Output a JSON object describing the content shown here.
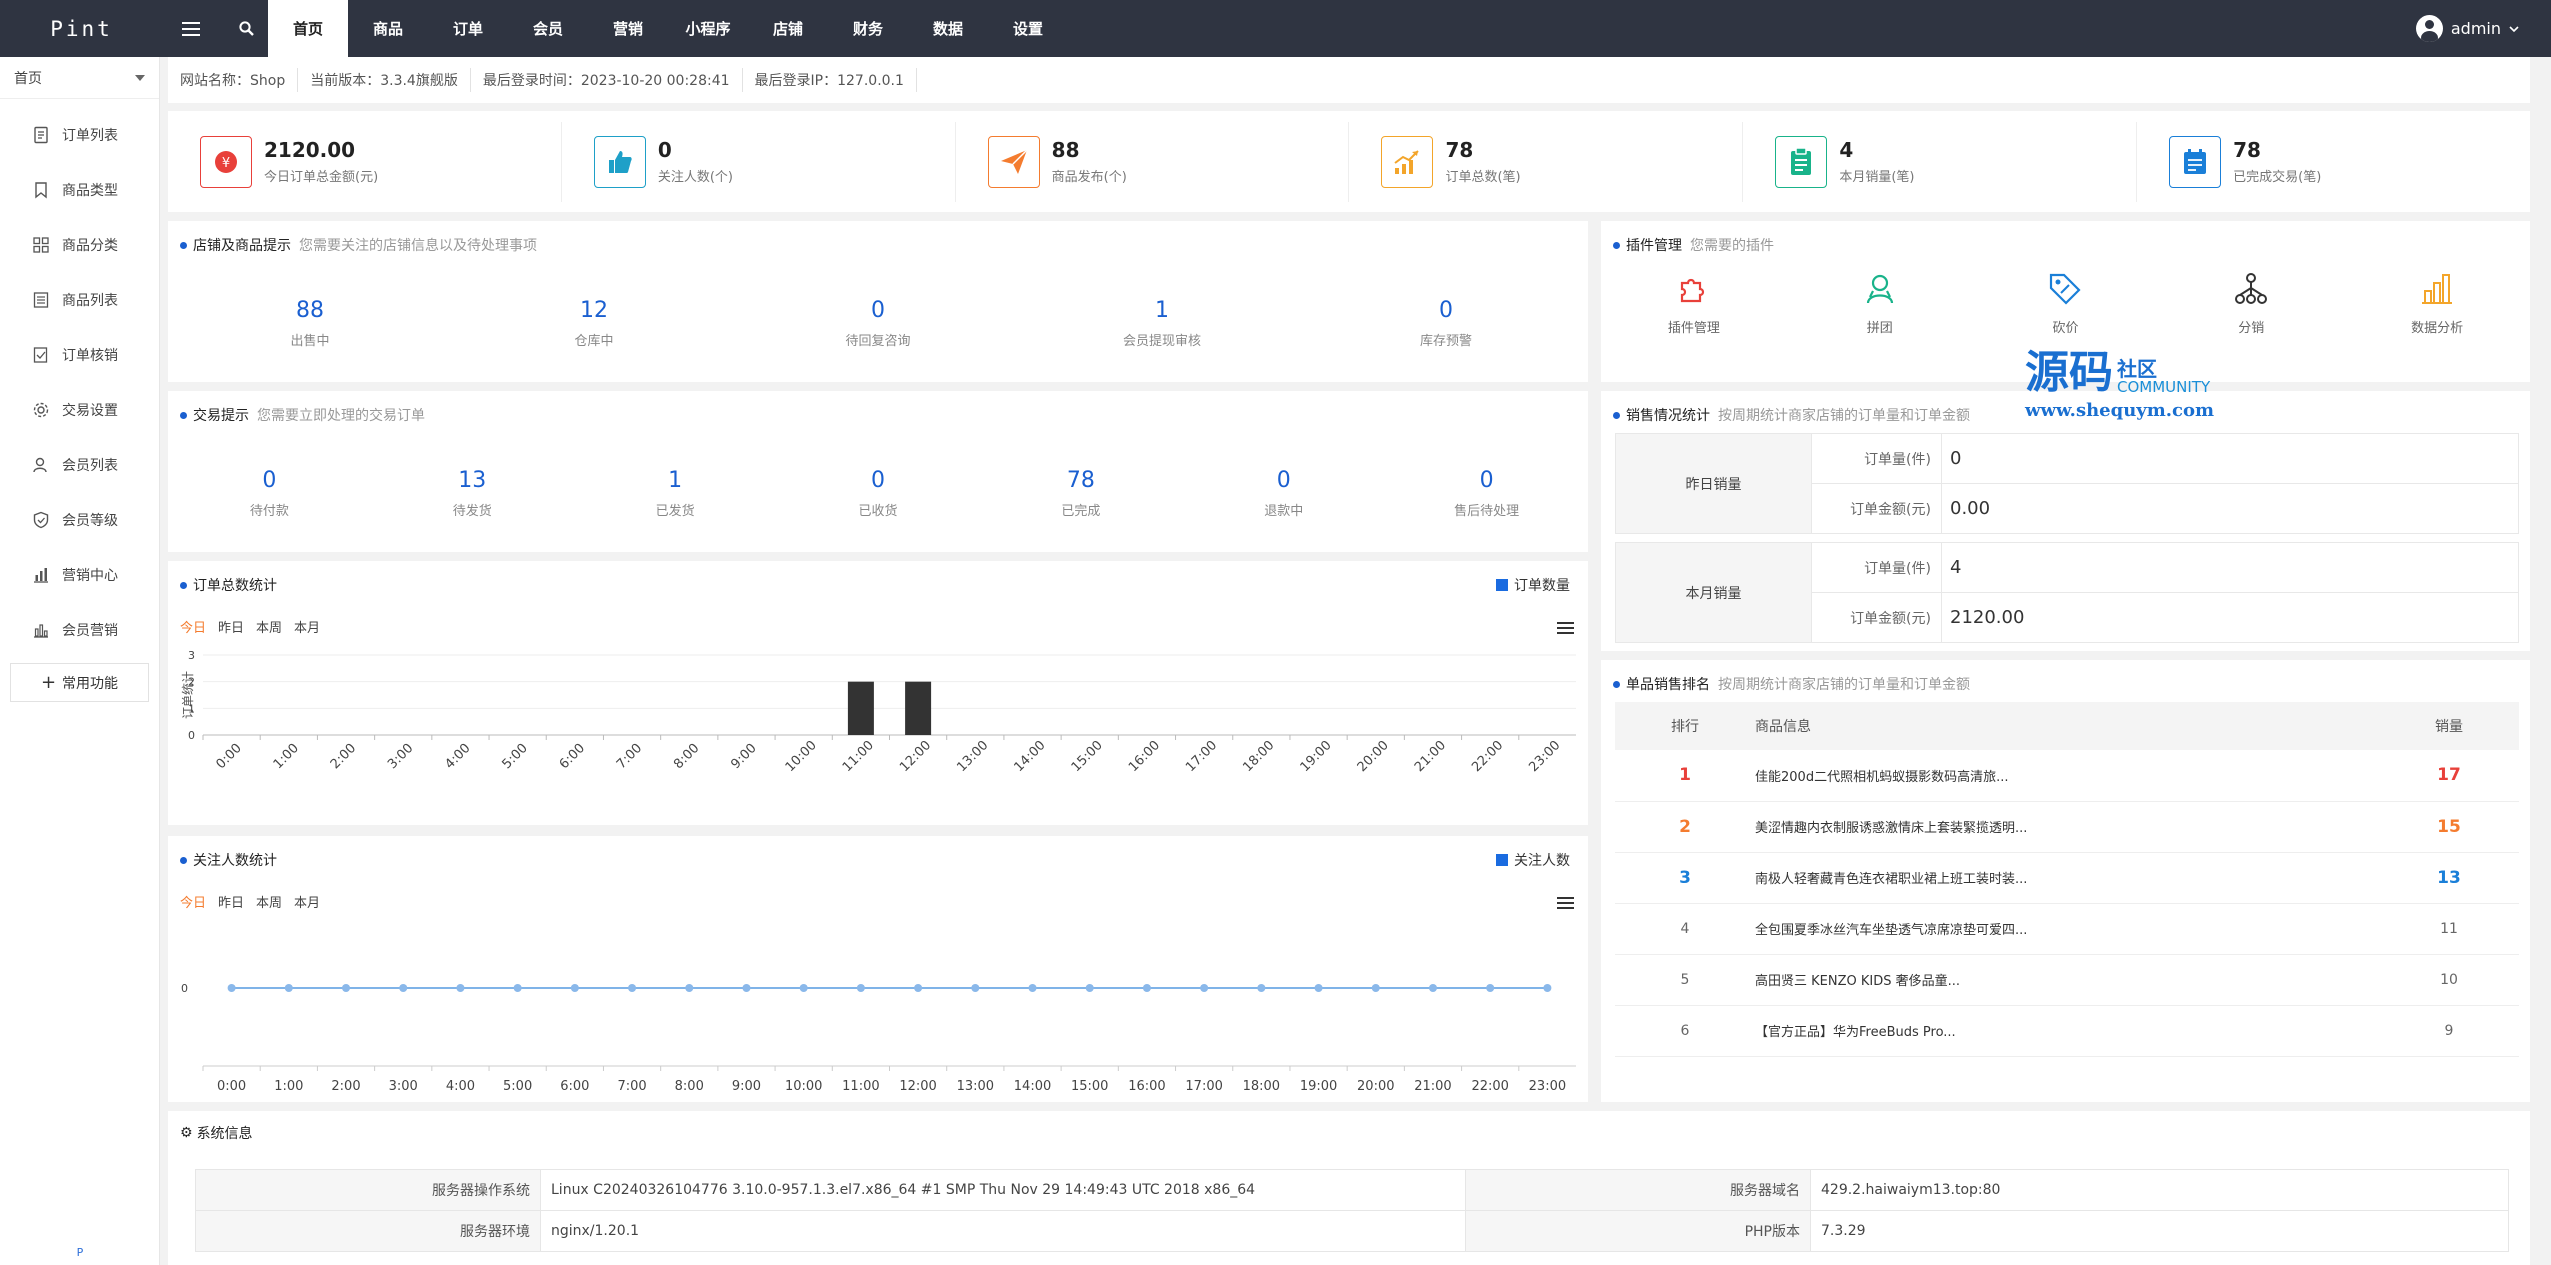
{
  "topbar": {
    "logo": "Pint",
    "nav": [
      "首页",
      "商品",
      "订单",
      "会员",
      "营销",
      "小程序",
      "店铺",
      "财务",
      "数据",
      "设置"
    ],
    "active_index": 0,
    "user": "admin"
  },
  "sidebar": {
    "header": "首页",
    "items": [
      {
        "label": "订单列表",
        "icon": "document-icon"
      },
      {
        "label": "商品类型",
        "icon": "bookmark-icon"
      },
      {
        "label": "商品分类",
        "icon": "grid-icon"
      },
      {
        "label": "商品列表",
        "icon": "list-icon"
      },
      {
        "label": "订单核销",
        "icon": "verify-icon"
      },
      {
        "label": "交易设置",
        "icon": "gear-icon"
      },
      {
        "label": "会员列表",
        "icon": "user-icon"
      },
      {
        "label": "会员等级",
        "icon": "shield-icon"
      },
      {
        "label": "营销中心",
        "icon": "bar-chart-icon"
      },
      {
        "label": "会员营销",
        "icon": "chart-icon"
      }
    ],
    "add_label": "常用功能",
    "bottom": "P"
  },
  "infobar": [
    "网站名称：Shop",
    "当前版本：3.3.4旗舰版",
    "最后登录时间：2023-10-20 00:28:41",
    "最后登录IP：127.0.0.1"
  ],
  "stats": [
    {
      "value": "2120.00",
      "label": "今日订单总金额(元)",
      "color": "#e8403a",
      "icon": "money-icon"
    },
    {
      "value": "0",
      "label": "关注人数(个)",
      "color": "#1ea0c8",
      "icon": "thumbs-up-icon"
    },
    {
      "value": "88",
      "label": "商品发布(个)",
      "color": "#f47c2f",
      "icon": "paper-plane-icon"
    },
    {
      "value": "78",
      "label": "订单总数(笔)",
      "color": "#f3a52a",
      "icon": "trend-icon"
    },
    {
      "value": "4",
      "label": "本月销量(笔)",
      "color": "#19b38a",
      "icon": "clipboard-icon"
    },
    {
      "value": "78",
      "label": "已完成交易(笔)",
      "color": "#1a7fd8",
      "icon": "calendar-icon"
    }
  ],
  "store_tips": {
    "title": "店铺及商品提示",
    "subtitle": "您需要关注的店铺信息以及待处理事项",
    "items": [
      {
        "value": "88",
        "label": "出售中"
      },
      {
        "value": "12",
        "label": "仓库中"
      },
      {
        "value": "0",
        "label": "待回复咨询"
      },
      {
        "value": "1",
        "label": "会员提现审核"
      },
      {
        "value": "0",
        "label": "库存预警"
      }
    ]
  },
  "trade_tips": {
    "title": "交易提示",
    "subtitle": "您需要立即处理的交易订单",
    "items": [
      {
        "value": "0",
        "label": "待付款"
      },
      {
        "value": "13",
        "label": "待发货"
      },
      {
        "value": "1",
        "label": "已发货"
      },
      {
        "value": "0",
        "label": "已收货"
      },
      {
        "value": "78",
        "label": "已完成"
      },
      {
        "value": "0",
        "label": "退款中"
      },
      {
        "value": "0",
        "label": "售后待处理"
      }
    ]
  },
  "ranges": [
    "今日",
    "昨日",
    "本周",
    "本月"
  ],
  "chart_data": [
    {
      "type": "bar",
      "title": "订单总数统计",
      "ylabel": "订单统计",
      "ylim": [
        0,
        3
      ],
      "yticks": [
        "0",
        "1",
        "2",
        "3"
      ],
      "categories": [
        "0:00",
        "1:00",
        "2:00",
        "3:00",
        "4:00",
        "5:00",
        "6:00",
        "7:00",
        "8:00",
        "9:00",
        "10:00",
        "11:00",
        "12:00",
        "13:00",
        "14:00",
        "15:00",
        "16:00",
        "17:00",
        "18:00",
        "19:00",
        "20:00",
        "21:00",
        "22:00",
        "23:00"
      ],
      "series": [
        {
          "name": "订单数量",
          "values": [
            0,
            0,
            0,
            0,
            0,
            0,
            0,
            0,
            0,
            0,
            0,
            2,
            2,
            0,
            0,
            0,
            0,
            0,
            0,
            0,
            0,
            0,
            0,
            0
          ]
        }
      ],
      "legend": "top-right"
    },
    {
      "type": "line",
      "title": "关注人数统计",
      "yticks": [
        "0"
      ],
      "categories": [
        "0:00",
        "1:00",
        "2:00",
        "3:00",
        "4:00",
        "5:00",
        "6:00",
        "7:00",
        "8:00",
        "9:00",
        "10:00",
        "11:00",
        "12:00",
        "13:00",
        "14:00",
        "15:00",
        "16:00",
        "17:00",
        "18:00",
        "19:00",
        "20:00",
        "21:00",
        "22:00",
        "23:00"
      ],
      "series": [
        {
          "name": "关注人数",
          "values": [
            0,
            0,
            0,
            0,
            0,
            0,
            0,
            0,
            0,
            0,
            0,
            0,
            0,
            0,
            0,
            0,
            0,
            0,
            0,
            0,
            0,
            0,
            0,
            0
          ]
        }
      ],
      "legend": "top-right"
    }
  ],
  "plugins": {
    "title": "插件管理",
    "subtitle": "您需要的插件",
    "items": [
      {
        "label": "插件管理",
        "icon": "puzzle-icon",
        "color": "#e8403a"
      },
      {
        "label": "拼团",
        "icon": "group-icon",
        "color": "#19b38a"
      },
      {
        "label": "砍价",
        "icon": "tag-icon",
        "color": "#1a7fd8"
      },
      {
        "label": "分销",
        "icon": "network-icon",
        "color": "#333333"
      },
      {
        "label": "数据分析",
        "icon": "bar-chart-icon",
        "color": "#f3a52a"
      }
    ]
  },
  "watermark": {
    "main": "源码",
    "sub1": "社区",
    "sub2": "COMMUNITY",
    "url": "www.shequym.com"
  },
  "sales_stats": {
    "title": "销售情况统计",
    "subtitle": "按周期统计商家店铺的订单量和订单金额",
    "groups": [
      {
        "name": "昨日销量",
        "rows": [
          {
            "key": "订单量(件)",
            "value": "0"
          },
          {
            "key": "订单金额(元)",
            "value": "0.00"
          }
        ]
      },
      {
        "name": "本月销量",
        "rows": [
          {
            "key": "订单量(件)",
            "value": "4"
          },
          {
            "key": "订单金额(元)",
            "value": "2120.00"
          }
        ]
      }
    ]
  },
  "ranking": {
    "title": "单品销售排名",
    "subtitle": "按周期统计商家店铺的订单量和订单金额",
    "headers": [
      "排行",
      "商品信息",
      "销量"
    ],
    "rows": [
      {
        "rank": "1",
        "name": "佳能200d二代照相机蚂蚁摄影数码高清旅...",
        "sales": "17",
        "color": "#e8403a"
      },
      {
        "rank": "2",
        "name": "美涩情趣内衣制服诱惑激情床上套装緊揽透明...",
        "sales": "15",
        "color": "#f47c2f"
      },
      {
        "rank": "3",
        "name": "南极人轻奢藏青色连衣裙职业裙上班工装时装...",
        "sales": "13",
        "color": "#1a7fd8"
      },
      {
        "rank": "4",
        "name": "全包围夏季冰丝汽车坐垫透气凉席凉垫可爱四...",
        "sales": "11",
        "color": "#666666"
      },
      {
        "rank": "5",
        "name": "高田贤三 KENZO KIDS 奢侈品童...",
        "sales": "10",
        "color": "#666666"
      },
      {
        "rank": "6",
        "name": "【官方正品】华为FreeBuds Pro...",
        "sales": "9",
        "color": "#666666"
      }
    ]
  },
  "sysinfo": {
    "title": "系统信息",
    "rows": [
      {
        "k1": "服务器操作系统",
        "v1": "Linux C20240326104776 3.10.0-957.1.3.el7.x86_64 #1 SMP Thu Nov 29 14:49:43 UTC 2018 x86_64",
        "k2": "服务器域名",
        "v2": "429.2.haiwaiym13.top:80"
      },
      {
        "k1": "服务器环境",
        "v1": "nginx/1.20.1",
        "k2": "PHP版本",
        "v2": "7.3.29"
      }
    ]
  }
}
